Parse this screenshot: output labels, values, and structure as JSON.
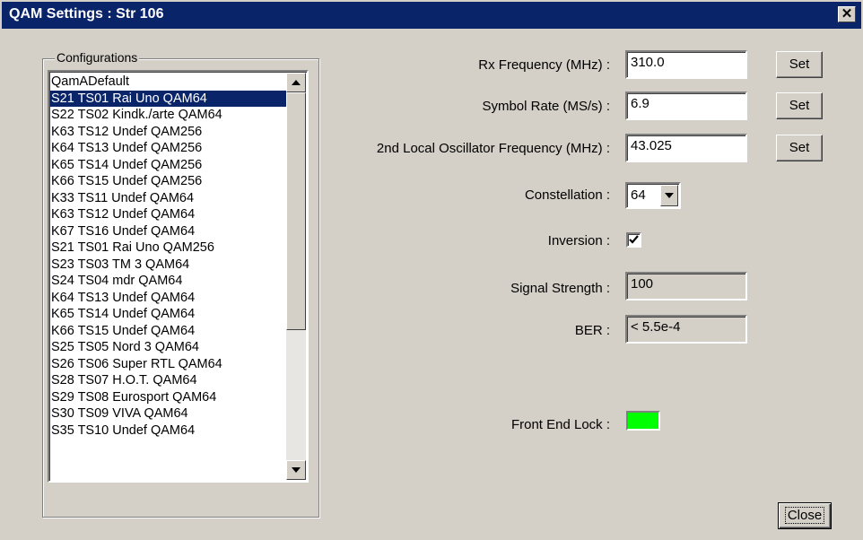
{
  "window": {
    "title": "QAM Settings : Str 106",
    "close_glyph": "✕"
  },
  "configurations": {
    "label": "Configurations",
    "selected_index": 1,
    "items": [
      "QamADefault",
      "S21 TS01 Rai Uno QAM64",
      "S22 TS02 Kindk./arte QAM64",
      "K63 TS12 Undef QAM256",
      "K64 TS13 Undef QAM256",
      "K65 TS14 Undef QAM256",
      "K66 TS15 Undef QAM256",
      "K33 TS11 Undef QAM64",
      "K63 TS12 Undef QAM64",
      "K67 TS16 Undef QAM64",
      "S21 TS01 Rai Uno QAM256",
      "S23 TS03 TM  3 QAM64",
      "S24 TS04 mdr QAM64",
      "K64 TS13 Undef QAM64",
      "K65 TS14 Undef QAM64",
      "K66 TS15 Undef QAM64",
      "S25 TS05 Nord 3 QAM64",
      "S26 TS06 Super RTL QAM64",
      "S28 TS07 H.O.T. QAM64",
      "S29 TS08 Eurosport QAM64",
      "S30 TS09 VIVA QAM64",
      "S35 TS10 Undef QAM64"
    ]
  },
  "settings": {
    "rx_frequency": {
      "label": "Rx Frequency (MHz) :",
      "value": "310.0",
      "button": "Set"
    },
    "symbol_rate": {
      "label": "Symbol Rate (MS/s) :",
      "value": "6.9",
      "button": "Set"
    },
    "lo2_frequency": {
      "label": "2nd Local Oscillator Frequency (MHz) :",
      "value": "43.025",
      "button": "Set"
    },
    "constellation": {
      "label": "Constellation :",
      "value": "64"
    },
    "inversion": {
      "label": "Inversion :",
      "checked": true
    },
    "signal_strength": {
      "label": "Signal Strength :",
      "value": "100"
    },
    "ber": {
      "label": "BER :",
      "value": "< 5.5e-4"
    },
    "front_end_lock": {
      "label": "Front End Lock :",
      "status_color": "#00ff00"
    }
  },
  "footer": {
    "close_label": "Close"
  },
  "colors": {
    "titlebar": "#0a246a",
    "face": "#d4d0c8",
    "selection": "#0a246a"
  },
  "icons": [
    "close-icon",
    "scroll-up-arrow-icon",
    "scroll-down-arrow-icon",
    "dropdown-arrow-icon",
    "checkmark-icon"
  ]
}
